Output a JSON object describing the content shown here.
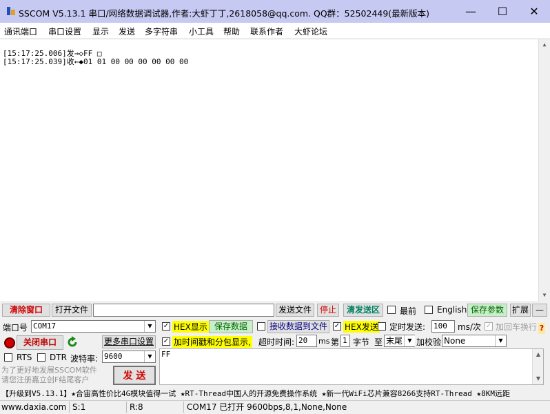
{
  "title": "SSCOM V5.13.1 串口/网络数据调试器,作者:大虾丁丁,2618058@qq.com. QQ群：52502449(最新版本)",
  "window_controls": {
    "minimize": "—",
    "maximize": "☐",
    "close": "✕"
  },
  "menu": [
    "通讯端口",
    "串口设置",
    "显示",
    "发送",
    "多字符串",
    "小工具",
    "帮助",
    "联系作者",
    "大虾论坛"
  ],
  "output_lines": [
    "[15:17:25.006]发→◇FF □",
    "[15:17:25.039]收←◆01 01 00 00 00 00 00 00"
  ],
  "toolbar": {
    "clear": "清除窗口",
    "open_file": "打开文件",
    "file_path": "",
    "send_file": "发送文件",
    "stop": "停止",
    "clear_send": "清发送区",
    "topmost": "最前",
    "english": "English",
    "save_params": "保存参数",
    "expand": "扩展",
    "dash": "—"
  },
  "port": {
    "label": "端口号",
    "value": "COM17",
    "close_port": "关闭串口",
    "more_settings": "更多串口设置",
    "rts": "RTS",
    "dtr": "DTR",
    "baud_label": "波特率:",
    "baud_value": "9600"
  },
  "options": {
    "hex_display": "HEX显示",
    "save_data": "保存数据",
    "recv_to_file": "接收数据到文件",
    "hex_send": "HEX发送",
    "timed_send": "定时发送:",
    "interval": "100",
    "interval_unit": "ms/次",
    "add_crlf": "加回车换行",
    "add_timestamp": "加时间戳和分包显示,",
    "timeout_label": "超时时间:",
    "timeout": "20",
    "timeout_unit": "ms",
    "nth_label": "第",
    "nth": "1",
    "byte_label": "字节",
    "to_label": "至",
    "end": "末尾",
    "checksum_label": "加校验",
    "checksum": "None"
  },
  "send_text": "FF",
  "promo": "为了更好地发展SSCOM软件\n请您注册嘉立创F结尾客户",
  "send_button": "发  送",
  "ticker": "【升级到V5.13.1】★合宙高性价比4G模块值得一试 ★RT-Thread中国人的开源免费操作系统 ★新一代WiFi芯片兼容8266支持RT-Thread ★8KM远距",
  "status": {
    "site": "www.daxia.com",
    "s": "S:1",
    "r": "R:8",
    "port_state": "COM17 已打开  9600bps,8,1,None,None"
  }
}
